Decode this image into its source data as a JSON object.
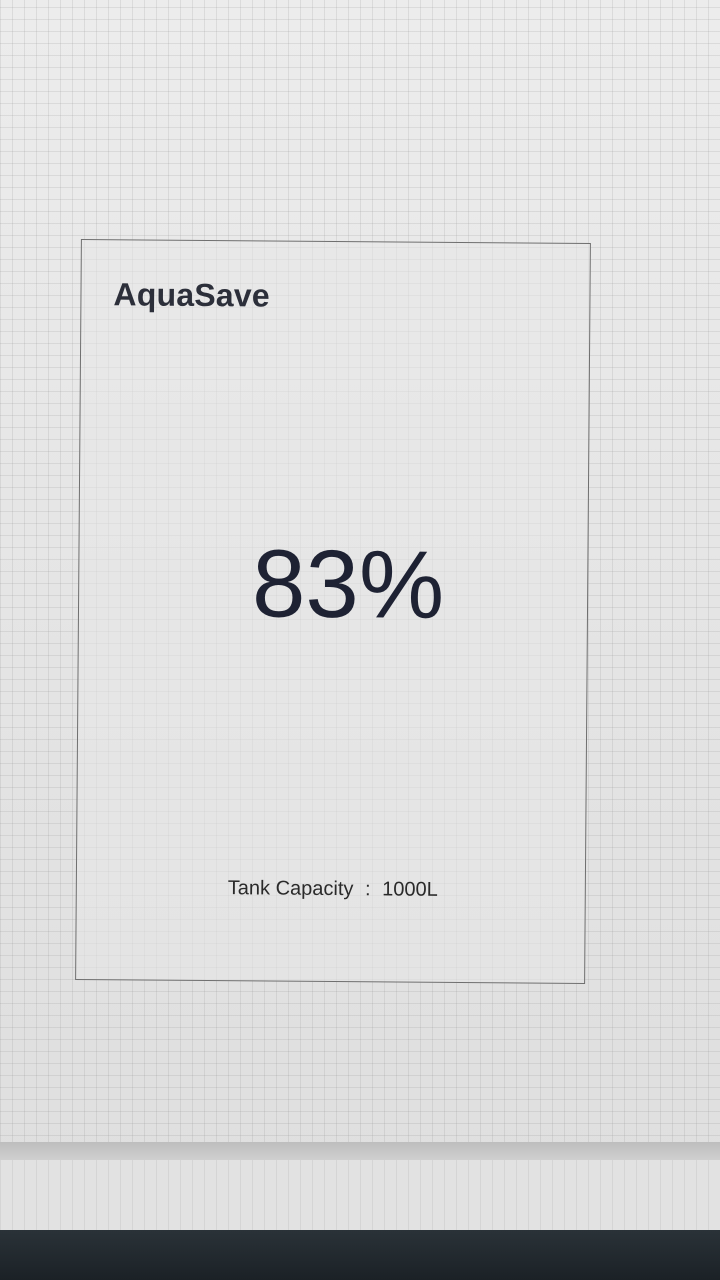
{
  "app": {
    "title": "AquaSave"
  },
  "tank": {
    "level_text": "83%",
    "level_percent": 83,
    "capacity_label": "Tank Capacity",
    "capacity_separator": ":",
    "capacity_value": "1000L"
  }
}
